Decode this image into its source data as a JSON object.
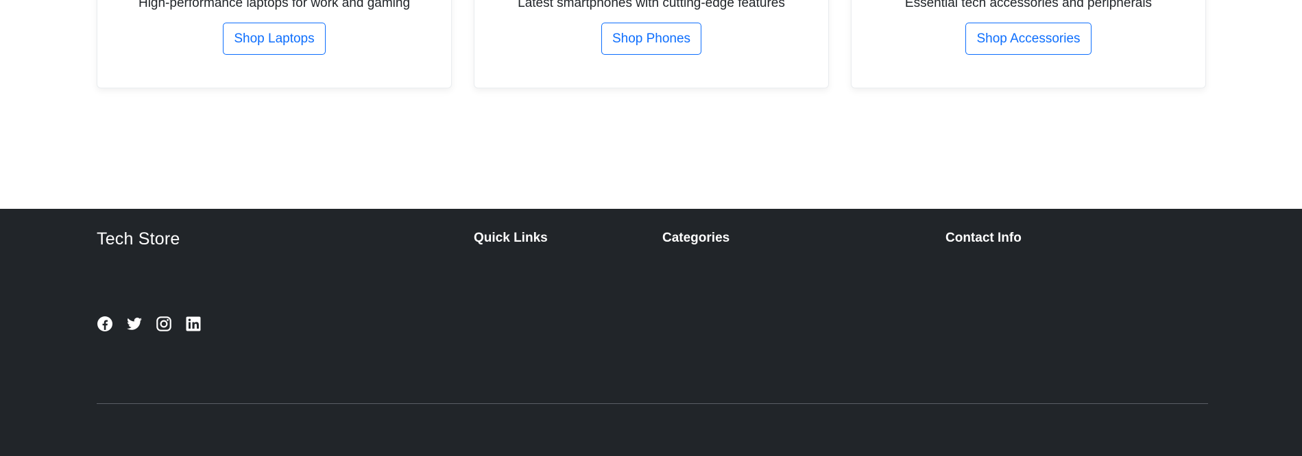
{
  "categories": [
    {
      "description": "High-performance laptops for work and gaming",
      "button_label": "Shop Laptops"
    },
    {
      "description": "Latest smartphones with cutting-edge features",
      "button_label": "Shop Phones"
    },
    {
      "description": "Essential tech accessories and peripherals",
      "button_label": "Shop Accessories"
    }
  ],
  "footer": {
    "brand": "Tech Store",
    "headings": {
      "quick_links": "Quick Links",
      "categories": "Categories",
      "contact": "Contact Info"
    },
    "social_icons": [
      "facebook-icon",
      "twitter-icon",
      "instagram-icon",
      "linkedin-icon"
    ]
  },
  "colors": {
    "primary": "#0d6efd",
    "footer_bg": "#212529",
    "page_bg": "#ffffff"
  }
}
